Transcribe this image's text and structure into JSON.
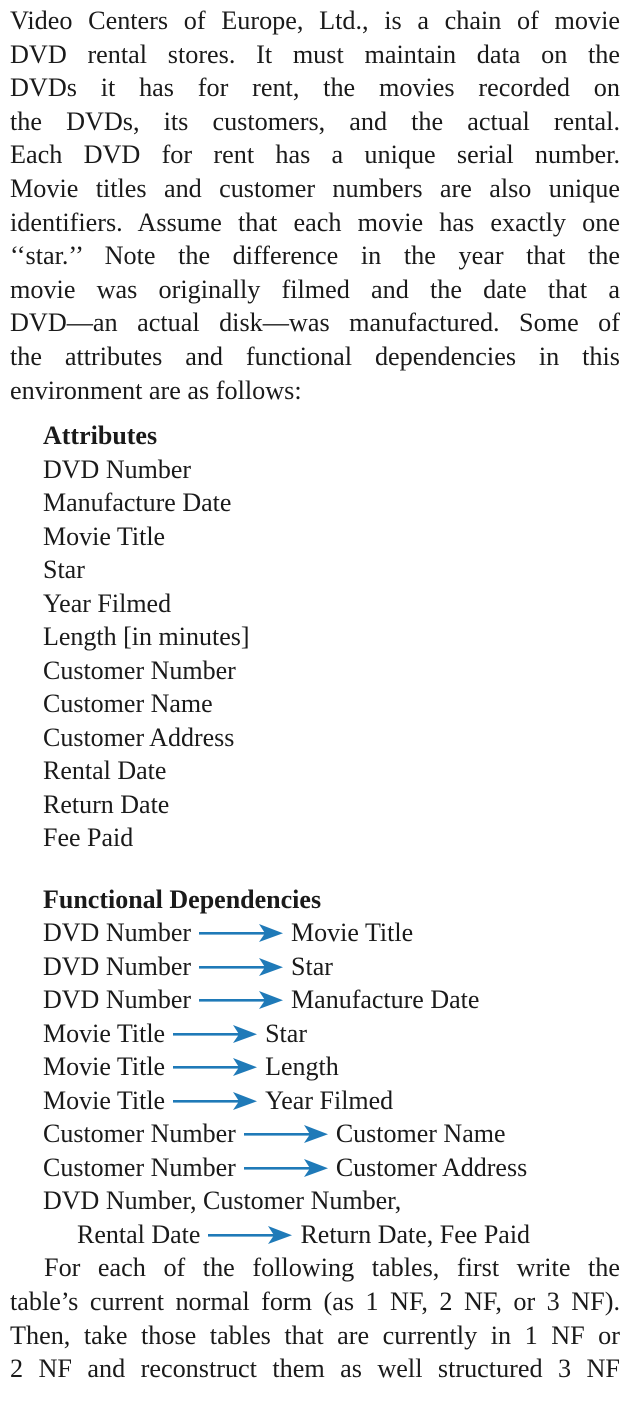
{
  "intro_lines": [
    "Video Centers of Europe, Ltd., is a chain of movie",
    "DVD rental stores. It must maintain data on the",
    "DVDs it has for rent, the movies recorded on",
    "the DVDs, its customers, and the actual rental.",
    "Each DVD for rent has a unique serial number.",
    "Movie titles and customer numbers are also unique",
    "identifiers. Assume that each movie has exactly one",
    "‘‘star.’’ Note the difference in the year that the",
    "movie was originally filmed and the date that a",
    "DVD—an actual disk—was manufactured. Some of",
    "the attributes and functional dependencies in this",
    "environment are as follows:"
  ],
  "attributes": {
    "title": "Attributes",
    "items": [
      "DVD Number",
      "Manufacture Date",
      "Movie Title",
      "Star",
      "Year Filmed",
      "Length [in minutes]",
      "Customer Number",
      "Customer Name",
      "Customer Address",
      "Rental Date",
      "Return Date",
      "Fee Paid"
    ]
  },
  "functional_dependencies": {
    "title": "Functional Dependencies",
    "arrow_color": "#1f7ab8",
    "items": [
      {
        "lhs": "DVD Number",
        "rhs": "Movie Title"
      },
      {
        "lhs": "DVD Number",
        "rhs": "Star"
      },
      {
        "lhs": "DVD Number",
        "rhs": "Manufacture Date"
      },
      {
        "lhs": "Movie Title",
        "rhs": "Star"
      },
      {
        "lhs": "Movie Title",
        "rhs": "Length"
      },
      {
        "lhs": "Movie Title",
        "rhs": "Year Filmed"
      },
      {
        "lhs": "Customer Number",
        "rhs": "Customer Name"
      },
      {
        "lhs": "Customer Number",
        "rhs": "Customer Address"
      }
    ],
    "composite": {
      "lhs_line1": "DVD Number, Customer Number,",
      "lhs_line2": "Rental Date",
      "rhs": "Return Date, Fee Paid"
    }
  },
  "closing_lines": [
    "For each of the following tables, first write the",
    "table’s current normal form (as 1 NF, 2 NF, or 3 NF).",
    "Then, take those tables that are currently in 1 NF or",
    "2 NF and reconstruct them as well structured 3 NF"
  ]
}
